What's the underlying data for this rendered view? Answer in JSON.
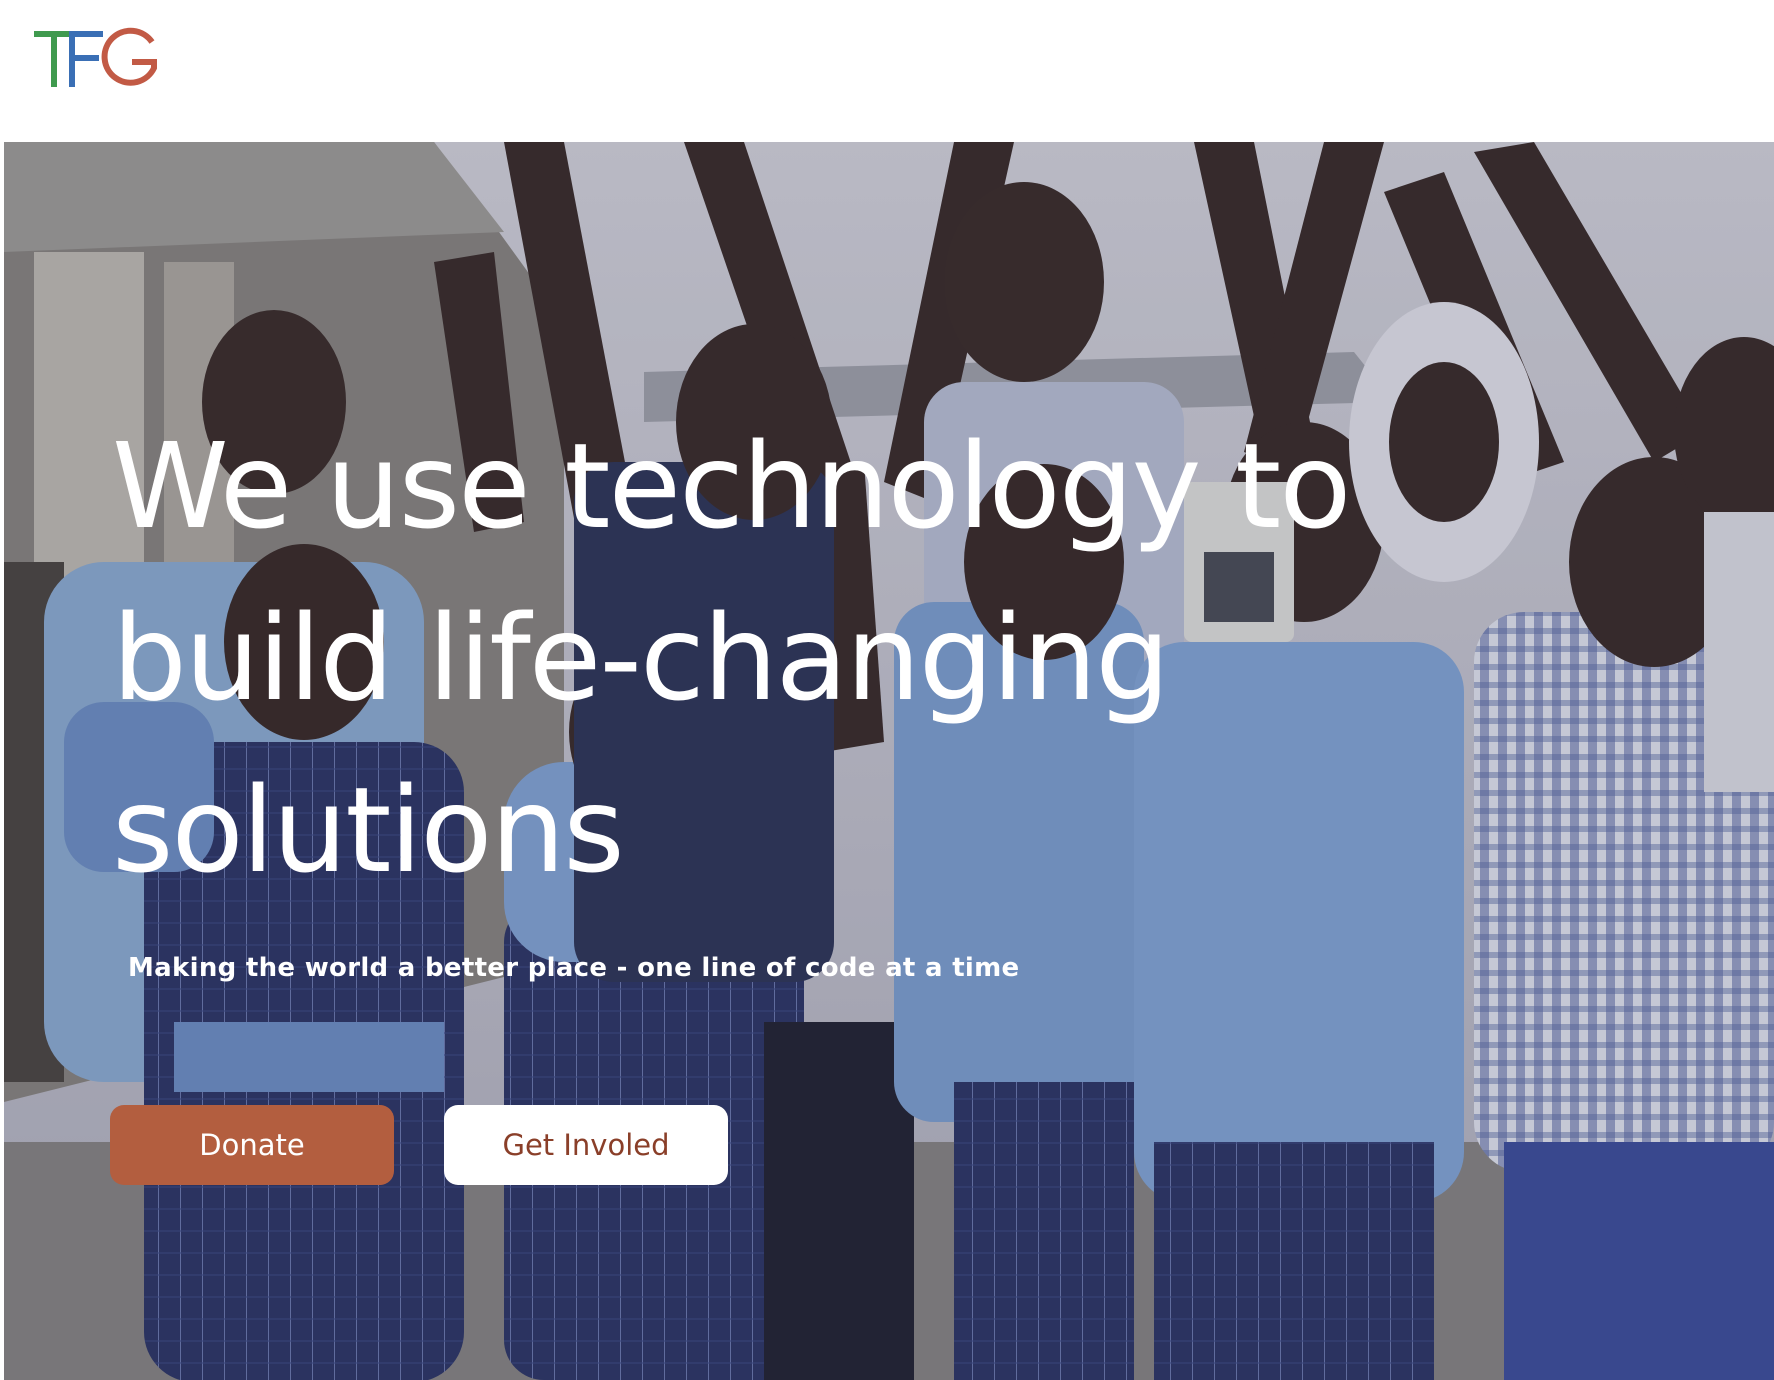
{
  "brand": {
    "logo_text": "TFG",
    "colors": {
      "t": "#3f9a4e",
      "f": "#3a6fb5",
      "g": "#c25a45"
    }
  },
  "hero": {
    "headline": "We use technology to build life-changing solutions",
    "tagline": "Making the world a better place - one line of code at a time",
    "background": "photo of school children in blue uniforms cheering with raised arms"
  },
  "actions": {
    "donate_label": "Donate",
    "get_involved_label": "Get Involed"
  },
  "theme": {
    "accent": "#b35e3f",
    "accent_text": "#8a3f29",
    "header_bg": "#ffffff"
  }
}
